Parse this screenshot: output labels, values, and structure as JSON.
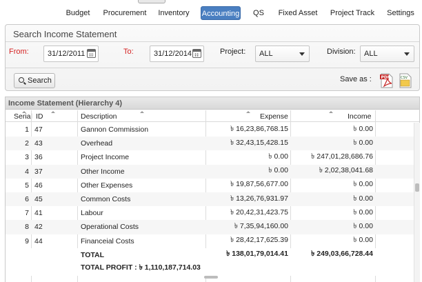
{
  "nav": {
    "items": [
      {
        "label": "Budget",
        "active": false
      },
      {
        "label": "Procurement",
        "active": false
      },
      {
        "label": "Inventory",
        "active": false
      },
      {
        "label": "Accounting",
        "active": true
      },
      {
        "label": "QS",
        "active": false
      },
      {
        "label": "Fixed Asset",
        "active": false
      },
      {
        "label": "Project Track",
        "active": false
      },
      {
        "label": "Settings",
        "active": false
      }
    ]
  },
  "search": {
    "title": "Search Income Statement",
    "from_label": "From:",
    "from_value": "31/12/2011",
    "to_label": "To:",
    "to_value": "31/12/2014",
    "project_label": "Project:",
    "project_value": "ALL",
    "division_label": "Division:",
    "division_value": "ALL",
    "search_button": "Search",
    "save_as_label": "Save as :",
    "pdf_icon_text": "PDF",
    "csv_icon_text": "CSV"
  },
  "grid": {
    "title": "Income Statement (Hierarchy 4)",
    "columns": {
      "serial": "Serial",
      "id": "ID",
      "description": "Description",
      "expense": "Expense",
      "income": "Income"
    },
    "rows": [
      {
        "serial": "1",
        "id": "47",
        "description": "Gannon Commission",
        "expense": "৳ 16,23,86,768.15",
        "income": "৳ 0.00"
      },
      {
        "serial": "2",
        "id": "43",
        "description": "Overhead",
        "expense": "৳ 32,43,15,428.15",
        "income": "৳ 0.00"
      },
      {
        "serial": "3",
        "id": "36",
        "description": "Project Income",
        "expense": "৳ 0.00",
        "income": "৳ 247,01,28,686.76"
      },
      {
        "serial": "4",
        "id": "37",
        "description": "Other Income",
        "expense": "৳ 0.00",
        "income": "৳ 2,02,38,041.68"
      },
      {
        "serial": "5",
        "id": "46",
        "description": "Other Expenses",
        "expense": "৳ 19,87,56,677.00",
        "income": "৳ 0.00"
      },
      {
        "serial": "6",
        "id": "45",
        "description": "Common Costs",
        "expense": "৳ 13,26,76,931.97",
        "income": "৳ 0.00"
      },
      {
        "serial": "7",
        "id": "41",
        "description": "Labour",
        "expense": "৳ 20,42,31,423.75",
        "income": "৳ 0.00"
      },
      {
        "serial": "8",
        "id": "42",
        "description": "Operational Costs",
        "expense": "৳ 7,35,94,160.00",
        "income": "৳ 0.00"
      },
      {
        "serial": "9",
        "id": "44",
        "description": "Financeial Costs",
        "expense": "৳ 28,42,17,625.39",
        "income": "৳ 0.00"
      }
    ],
    "total": {
      "label": "TOTAL",
      "expense": "৳ 138,01,79,014.41",
      "income": "৳ 249,03,66,728.44"
    },
    "profit": {
      "label": "TOTAL PROFIT : ৳ 1,110,187,714.03"
    }
  },
  "colors": {
    "accent": "#4a7fc1",
    "required_label": "#d42020"
  }
}
